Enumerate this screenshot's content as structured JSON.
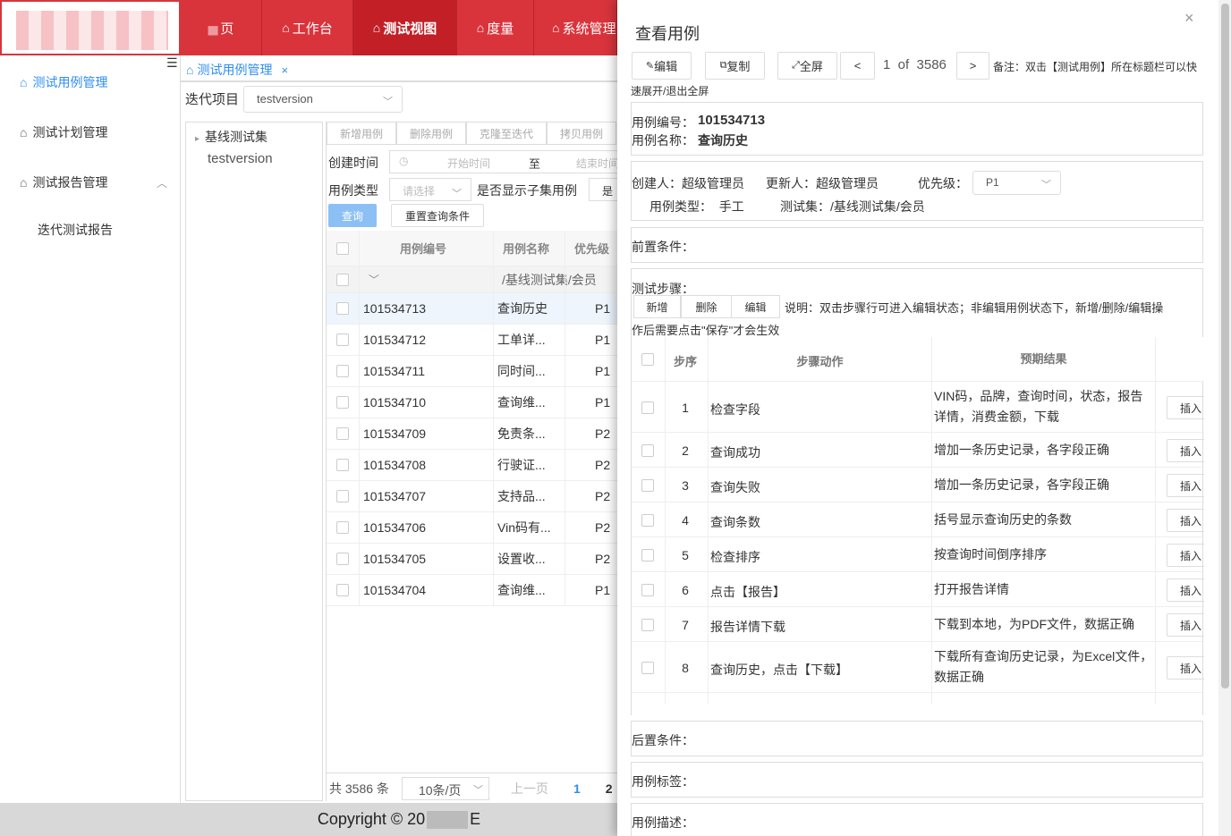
{
  "topnav": {
    "tabs": [
      {
        "label": "页",
        "icon": "home-icon"
      },
      {
        "label": "工作台",
        "icon": "home-icon"
      },
      {
        "label": "测试视图",
        "icon": "home-icon",
        "active": true
      },
      {
        "label": "度量",
        "icon": "home-icon"
      },
      {
        "label": "系统管理",
        "icon": "home-icon"
      }
    ]
  },
  "sidebar": {
    "items": [
      {
        "label": "测试用例管理",
        "active": true
      },
      {
        "label": "测试计划管理"
      },
      {
        "label": "测试报告管理"
      }
    ],
    "sub": "迭代测试报告"
  },
  "page_tab": {
    "label": "测试用例管理",
    "close": "×"
  },
  "iteration": {
    "label": "迭代项目",
    "value": "testversion"
  },
  "tree": {
    "root": "基线测试集",
    "child": "testversion"
  },
  "list": {
    "buttons": [
      "新增用例",
      "删除用例",
      "克隆至迭代",
      "拷贝用例"
    ],
    "created_label": "创建时间",
    "start_placeholder": "开始时间",
    "to": "至",
    "end_placeholder": "结束时间",
    "type_label": "用例类型",
    "type_placeholder": "请选择",
    "show_sub_label": "是否显示子集用例",
    "show_sub_value": "是",
    "query": "查询",
    "reset": "重置查询条件",
    "headers": [
      "用例编号",
      "用例名称",
      "优先级"
    ],
    "group_path": "/基线测试集/会员",
    "rows": [
      {
        "id": "101534713",
        "name": "查询历史",
        "pri": "P1"
      },
      {
        "id": "101534712",
        "name": "工单详...",
        "pri": "P1"
      },
      {
        "id": "101534711",
        "name": "同时间...",
        "pri": "P1"
      },
      {
        "id": "101534710",
        "name": "查询维...",
        "pri": "P1"
      },
      {
        "id": "101534709",
        "name": "免责条...",
        "pri": "P2"
      },
      {
        "id": "101534708",
        "name": "行驶证...",
        "pri": "P2"
      },
      {
        "id": "101534707",
        "name": "支持品...",
        "pri": "P2"
      },
      {
        "id": "101534706",
        "name": "Vin码有...",
        "pri": "P2"
      },
      {
        "id": "101534705",
        "name": "设置收...",
        "pri": "P2"
      },
      {
        "id": "101534704",
        "name": "查询维...",
        "pri": "P1"
      }
    ],
    "total": "共 3586 条",
    "page_size": "10条/页",
    "prev": "上一页",
    "page1": "1",
    "page2": "2"
  },
  "footer": {
    "text": "Copyright © 20",
    "tail": "E"
  },
  "drawer": {
    "title": "查看用例",
    "close": "×",
    "edit": "编辑",
    "copy": "复制",
    "fullscreen": "全屏",
    "prev": "<",
    "next": ">",
    "position": "1  of  3586",
    "note_line1": "备注：双击【测试用例】所在标题栏可以快",
    "note_line2": "速展开/退出全屏",
    "case_no_label": "用例编号：",
    "case_no": "101534713",
    "case_name_label": "用例名称：",
    "case_name": "查询历史",
    "creator": "创建人：超级管理员",
    "updater": "更新人：超级管理员",
    "priority_label": "优先级：",
    "priority": "P1",
    "type": "用例类型：  手工",
    "suite": "测试集：/基线测试集/会员",
    "precond": "前置条件：",
    "steps_label": "测试步骤：",
    "steps_buttons": [
      "新增",
      "删除",
      "编辑"
    ],
    "steps_note1": "说明：双击步骤行可进入编辑状态；非编辑用例状态下，新增/删除/编辑操",
    "steps_note2": "作后需要点击\"保存\"才会生效",
    "steps_headers": [
      "步序",
      "步骤动作",
      "预期结果"
    ],
    "steps": [
      {
        "seq": "1",
        "action": "检查字段",
        "expect": "VIN码，品牌，查询时间，状态，报告详情，消费金额，下载"
      },
      {
        "seq": "2",
        "action": "查询成功",
        "expect": "增加一条历史记录，各字段正确"
      },
      {
        "seq": "3",
        "action": "查询失败",
        "expect": "增加一条历史记录，各字段正确"
      },
      {
        "seq": "4",
        "action": "查询条数",
        "expect": "括号显示查询历史的条数"
      },
      {
        "seq": "5",
        "action": "检查排序",
        "expect": "按查询时间倒序排序"
      },
      {
        "seq": "6",
        "action": "点击【报告】",
        "expect": "打开报告详情"
      },
      {
        "seq": "7",
        "action": "报告详情下载",
        "expect": "下载到本地，为PDF文件，数据正确"
      },
      {
        "seq": "8",
        "action": "查询历史，点击【下载】",
        "expect": "下载所有查询历史记录，为Excel文件，数据正确"
      }
    ],
    "insert": "插入",
    "postcond": "后置条件：",
    "tags": "用例标签：",
    "desc": "用例描述："
  }
}
